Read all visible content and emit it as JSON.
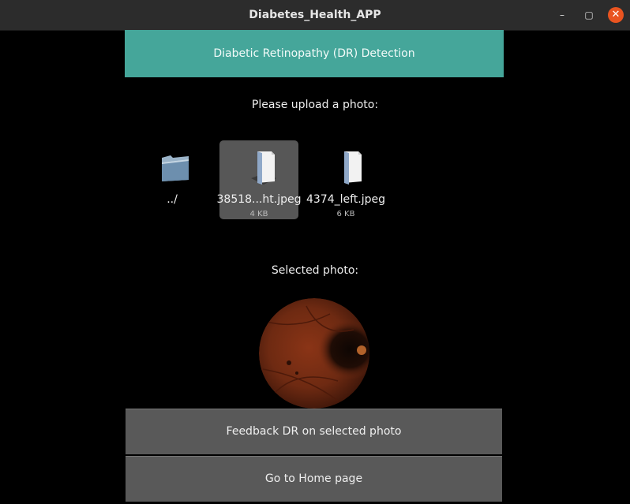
{
  "window": {
    "title": "Diabetes_Health_APP",
    "minimize_glyph": "–",
    "maximize_glyph": "▢",
    "close_glyph": "✕"
  },
  "header": {
    "title": "Diabetic Retinopathy (DR) Detection"
  },
  "upload": {
    "label": "Please upload a photo:",
    "files": [
      {
        "name": "../",
        "size": "",
        "icon": "folder-icon",
        "selected": false
      },
      {
        "name": "38518...ht.jpeg",
        "size": "4 KB",
        "icon": "file-icon",
        "selected": true
      },
      {
        "name": "4374_left.jpeg",
        "size": "6 KB",
        "icon": "file-icon",
        "selected": false
      }
    ]
  },
  "preview": {
    "label": "Selected photo:"
  },
  "buttons": {
    "feedback": "Feedback DR on selected photo",
    "home": "Go to Home page"
  },
  "colors": {
    "accent": "#45a69a",
    "button_bg": "#595959",
    "selection_bg": "#575757",
    "close_button": "#e95420"
  }
}
